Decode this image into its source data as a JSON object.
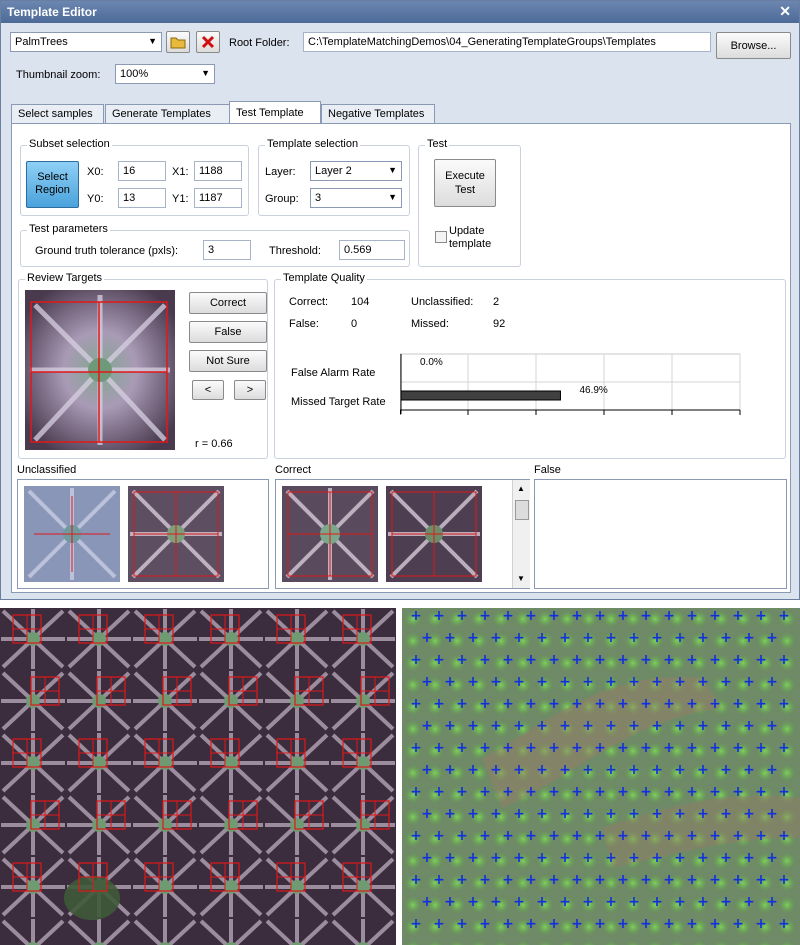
{
  "window": {
    "title": "Template Editor",
    "close_glyph": "✕"
  },
  "toolbar": {
    "template_group": "PalmTrees",
    "folder_icon": "folder-open-icon",
    "delete_icon": "delete-x-icon",
    "root_folder_label": "Root Folder:",
    "root_folder_value": "C:\\TemplateMatchingDemos\\04_GeneratingTemplateGroups\\Templates",
    "browse_label": "Browse...",
    "thumbnail_zoom_label": "Thumbnail zoom:",
    "thumbnail_zoom_value": "100%"
  },
  "tabs": [
    "Select samples",
    "Generate Templates",
    "Test Template",
    "Negative Templates"
  ],
  "subset": {
    "title": "Subset selection",
    "select_region_line1": "Select",
    "select_region_line2": "Region",
    "x0_label": "X0:",
    "x0": "16",
    "x1_label": "X1:",
    "x1": "1188",
    "y0_label": "Y0:",
    "y0": "13",
    "y1_label": "Y1:",
    "y1": "1187"
  },
  "template_selection": {
    "title": "Template selection",
    "layer_label": "Layer:",
    "layer_value": "Layer 2",
    "group_label": "Group:",
    "group_value": "3"
  },
  "test": {
    "title": "Test",
    "execute_line1": "Execute",
    "execute_line2": "Test",
    "update_line1": "Update",
    "update_line2": "template",
    "update_checked": false
  },
  "test_parameters": {
    "title": "Test parameters",
    "tolerance_label": "Ground truth tolerance (pxls):",
    "tolerance": "3",
    "threshold_label": "Threshold:",
    "threshold": "0.569"
  },
  "review": {
    "title": "Review Targets",
    "correct_label": "Correct",
    "false_label": "False",
    "not_sure_label": "Not Sure",
    "prev_label": "<",
    "next_label": ">",
    "r_value": "r = 0.66"
  },
  "quality": {
    "title": "Template Quality",
    "correct_label": "Correct:",
    "correct": "104",
    "unclassified_label": "Unclassified:",
    "unclassified": "2",
    "false_label": "False:",
    "false": "0",
    "missed_label": "Missed:",
    "missed": "92",
    "far_label": "False Alarm Rate",
    "far_value": "0.0%",
    "mtr_label": "Missed Target Rate",
    "mtr_value": "46.9%"
  },
  "chart_data": {
    "type": "bar",
    "orientation": "horizontal",
    "categories": [
      "False Alarm Rate",
      "Missed Target Rate"
    ],
    "values": [
      0.0,
      46.9
    ],
    "value_labels": [
      "0.0%",
      "46.9%"
    ],
    "xlim": [
      0,
      100
    ],
    "grid": true
  },
  "lists": {
    "unclassified_title": "Unclassified",
    "correct_title": "Correct",
    "false_title": "False"
  },
  "colors": {
    "crosshair": "#e01818",
    "detection_marker": "#1030e0",
    "selected_button": "#5fb3e8"
  },
  "detection_glyph": "+"
}
